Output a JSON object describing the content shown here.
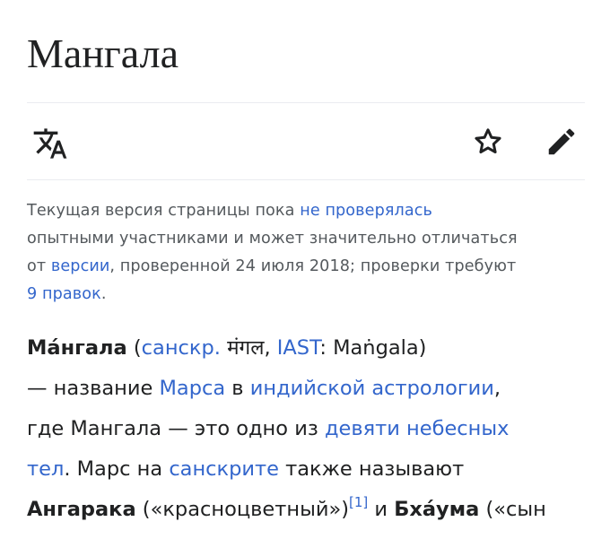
{
  "page": {
    "title": "Мангала"
  },
  "toolbar": {
    "language_icon": "translate-icon",
    "watch_icon": "star-icon",
    "edit_icon": "pencil-icon",
    "accent_color": "#3366cc",
    "icon_color": "#202122"
  },
  "notice": {
    "line1_text": "Текущая версия страницы пока ",
    "line1_link": "не проверялась",
    "line2_text": "опытными участниками и может значительно отличаться",
    "line3_prefix": "от ",
    "line3_link": "версии",
    "line3_suffix": ", проверенной 24 июля 2018; проверки требуют",
    "line4_link": "9 правок",
    "line4_suffix": "."
  },
  "article": {
    "term_bold": "Ма́нгала",
    "open_paren": " (",
    "sanskrit_abbr_link": "санскр.",
    "devanagari": " मंगल, ",
    "iast_link": "IAST",
    "iast_value": ": Maṅgala)",
    "line2_prefix": "— название ",
    "mars_link": "Марса",
    "line2_mid": " в ",
    "astrology_link": "индийской астрологии",
    "line2_suffix": ",",
    "line3_prefix": "где Мангала — это одно из ",
    "nine_bodies_link_part1": "девяти небесных",
    "nine_bodies_link_part2": "тел",
    "line4_mid": ". Марс на ",
    "sanskrit_link": "санскрите",
    "line4_suffix": " также называют",
    "angaraka_bold": "Ангарака",
    "angaraka_gloss": " («красноцветный»)",
    "ref_1": "[1]",
    "and_word": " и ",
    "bhauma_bold": "Бха́ума",
    "bhauma_gloss": " («сын"
  }
}
